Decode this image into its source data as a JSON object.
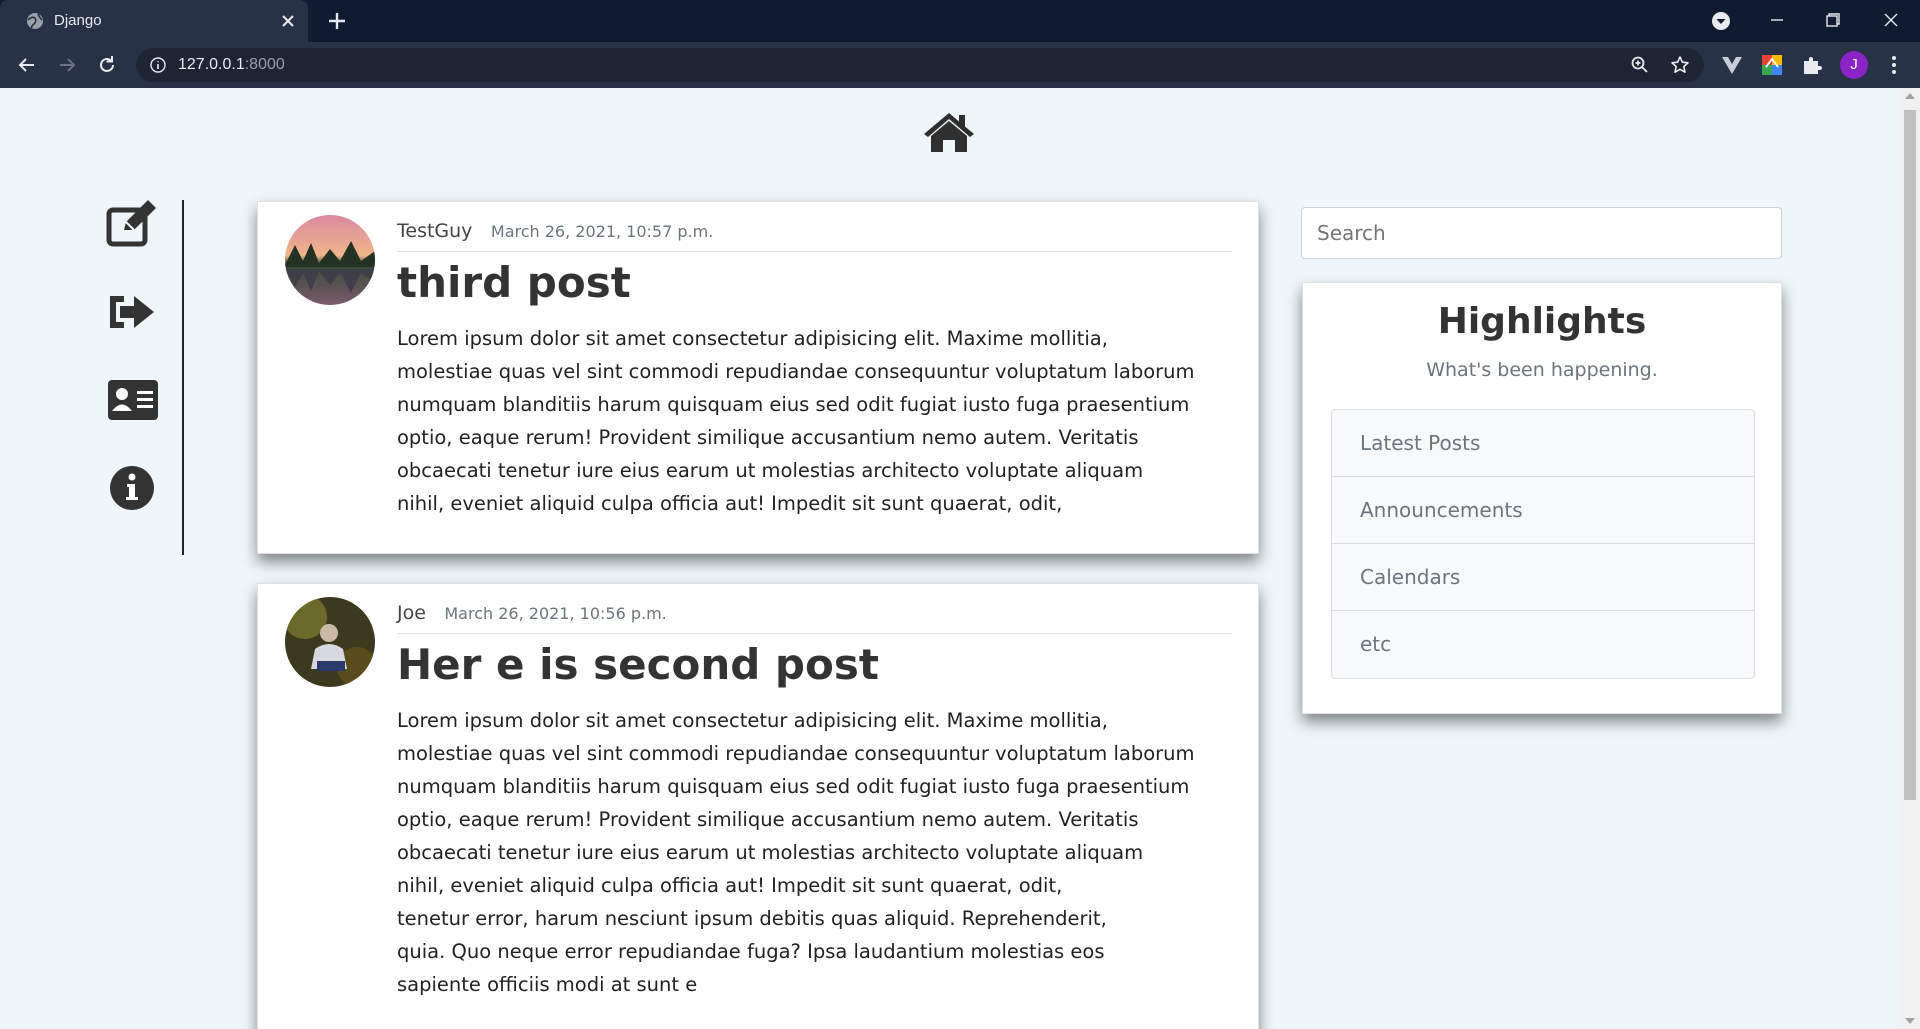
{
  "browser": {
    "tab_title": "Django",
    "url_host": "127.0.0.1",
    "url_port": ":8000"
  },
  "nav": {
    "home_icon": "home-icon",
    "side_icons": [
      "edit-icon",
      "sign-out-icon",
      "id-card-icon",
      "info-icon"
    ]
  },
  "posts": [
    {
      "author": "TestGuy",
      "date": "March 26, 2021, 10:57 p.m.",
      "title": "third post",
      "body_lines": [
        "Lorem ipsum dolor sit amet consectetur adipisicing elit. Maxime mollitia,",
        "molestiae quas vel sint commodi repudiandae consequuntur voluptatum laborum",
        "numquam blanditiis harum quisquam eius sed odit fugiat iusto fuga praesentium",
        "optio, eaque rerum! Provident similique accusantium nemo autem. Veritatis",
        "obcaecati tenetur iure eius earum ut molestias architecto voluptate aliquam",
        "nihil, eveniet aliquid culpa officia aut! Impedit sit sunt quaerat, odit,"
      ]
    },
    {
      "author": "Joe",
      "date": "March 26, 2021, 10:56 p.m.",
      "title": "Her e is second post",
      "body_lines": [
        "Lorem ipsum dolor sit amet consectetur adipisicing elit. Maxime mollitia,",
        "molestiae quas vel sint commodi repudiandae consequuntur voluptatum laborum",
        "numquam blanditiis harum quisquam eius sed odit fugiat iusto fuga praesentium",
        "optio, eaque rerum! Provident similique accusantium nemo autem. Veritatis",
        "obcaecati tenetur iure eius earum ut molestias architecto voluptate aliquam",
        "nihil, eveniet aliquid culpa officia aut! Impedit sit sunt quaerat, odit,",
        "tenetur error, harum nesciunt ipsum debitis quas aliquid. Reprehenderit,",
        "quia. Quo neque error repudiandae fuga? Ipsa laudantium molestias eos",
        "sapiente officiis modi at sunt e"
      ]
    }
  ],
  "sidebar": {
    "search_placeholder": "Search",
    "highlights_title": "Highlights",
    "highlights_subtitle": "What's been happening.",
    "items": [
      "Latest Posts",
      "Announcements",
      "Calendars",
      "etc"
    ]
  },
  "profile": {
    "initial": "J"
  },
  "colors": {
    "chrome_dark": "#0e1b31",
    "chrome_toolbar": "#273247",
    "page_bg": "#eef6f9",
    "profile": "#8b24c7"
  }
}
